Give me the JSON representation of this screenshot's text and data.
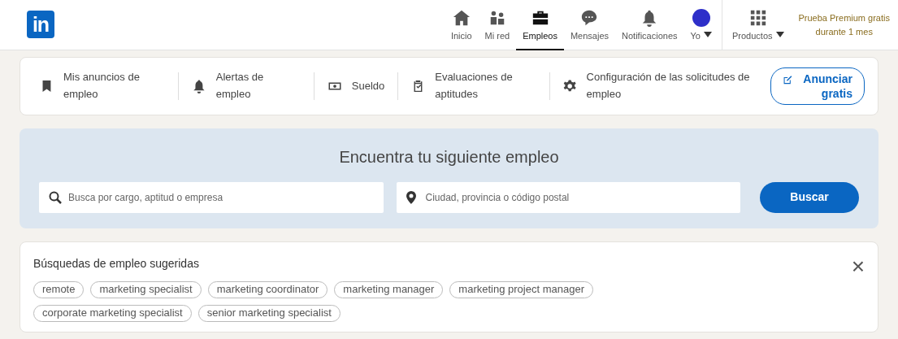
{
  "logo": "in",
  "nav": {
    "items": [
      {
        "kind": "home",
        "label": "Inicio",
        "selected": false
      },
      {
        "kind": "people",
        "label": "Mi red",
        "selected": false
      },
      {
        "kind": "briefcase",
        "label": "Empleos",
        "selected": true
      },
      {
        "kind": "chat",
        "label": "Mensajes",
        "selected": false
      },
      {
        "kind": "bell",
        "label": "Notificaciones",
        "selected": false
      },
      {
        "kind": "avatar",
        "label": "Yo",
        "selected": false
      },
      {
        "kind": "grid",
        "label": "Productos",
        "selected": false
      }
    ],
    "premium": [
      "Prueba Premium gratis",
      "durante 1 mes"
    ]
  },
  "subnav": {
    "items": [
      {
        "kind": "bookmark",
        "label": "Mis anuncios de empleo"
      },
      {
        "kind": "bell",
        "label": "Alertas de empleo"
      },
      {
        "kind": "money",
        "label": "Sueldo"
      },
      {
        "kind": "clipboard",
        "label": "Evaluaciones de aptitudes"
      },
      {
        "kind": "gear",
        "label": "Configuración de las solicitudes de empleo"
      }
    ],
    "post_button": "Anunciar gratis"
  },
  "search": {
    "title": "Encuentra tu siguiente empleo",
    "keyword_placeholder": "Busca por cargo, aptitud o empresa",
    "location_placeholder": "Ciudad, provincia o código postal",
    "button": "Buscar"
  },
  "suggestions": {
    "title": "Búsquedas de empleo sugeridas",
    "close": "×",
    "chips": [
      "remote",
      "marketing specialist",
      "marketing coordinator",
      "marketing manager",
      "marketing project manager",
      "corporate marketing specialist",
      "senior marketing specialist"
    ]
  }
}
